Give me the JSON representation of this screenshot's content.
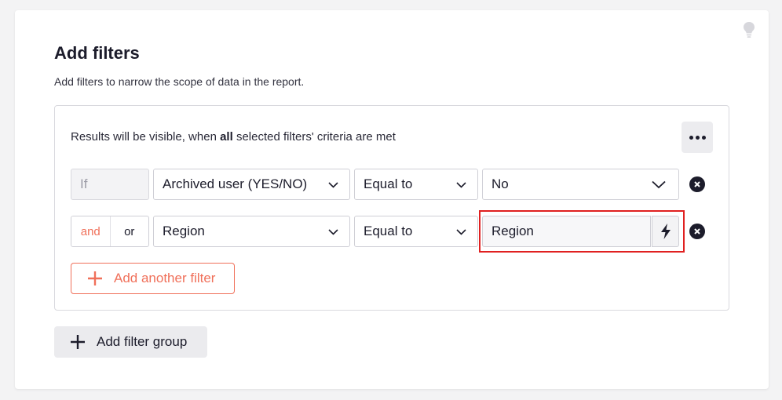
{
  "header": {
    "title": "Add filters",
    "subtitle": "Add filters to narrow the scope of data in the report."
  },
  "panel": {
    "criteria_prefix": "Results will be visible, when",
    "criteria_bold": "all",
    "criteria_suffix": "selected filters' criteria are met"
  },
  "rows": [
    {
      "connector": "If",
      "field": "Archived user (YES/NO)",
      "operator": "Equal to",
      "value": "No"
    },
    {
      "connector_and": "and",
      "connector_or": "or",
      "field": "Region",
      "operator": "Equal to",
      "value": "Region"
    }
  ],
  "buttons": {
    "add_filter": "Add another filter",
    "add_group": "Add filter group"
  },
  "icons": {
    "more": "ellipsis-icon",
    "bulb": "lightbulb-icon",
    "chevron": "chevron-down-icon",
    "bolt": "lightning-icon",
    "remove": "close-circle-icon",
    "plus": "plus-icon"
  },
  "colors": {
    "accent": "#f0705a",
    "dark": "#1c1c2b",
    "highlight": "#e02020"
  }
}
